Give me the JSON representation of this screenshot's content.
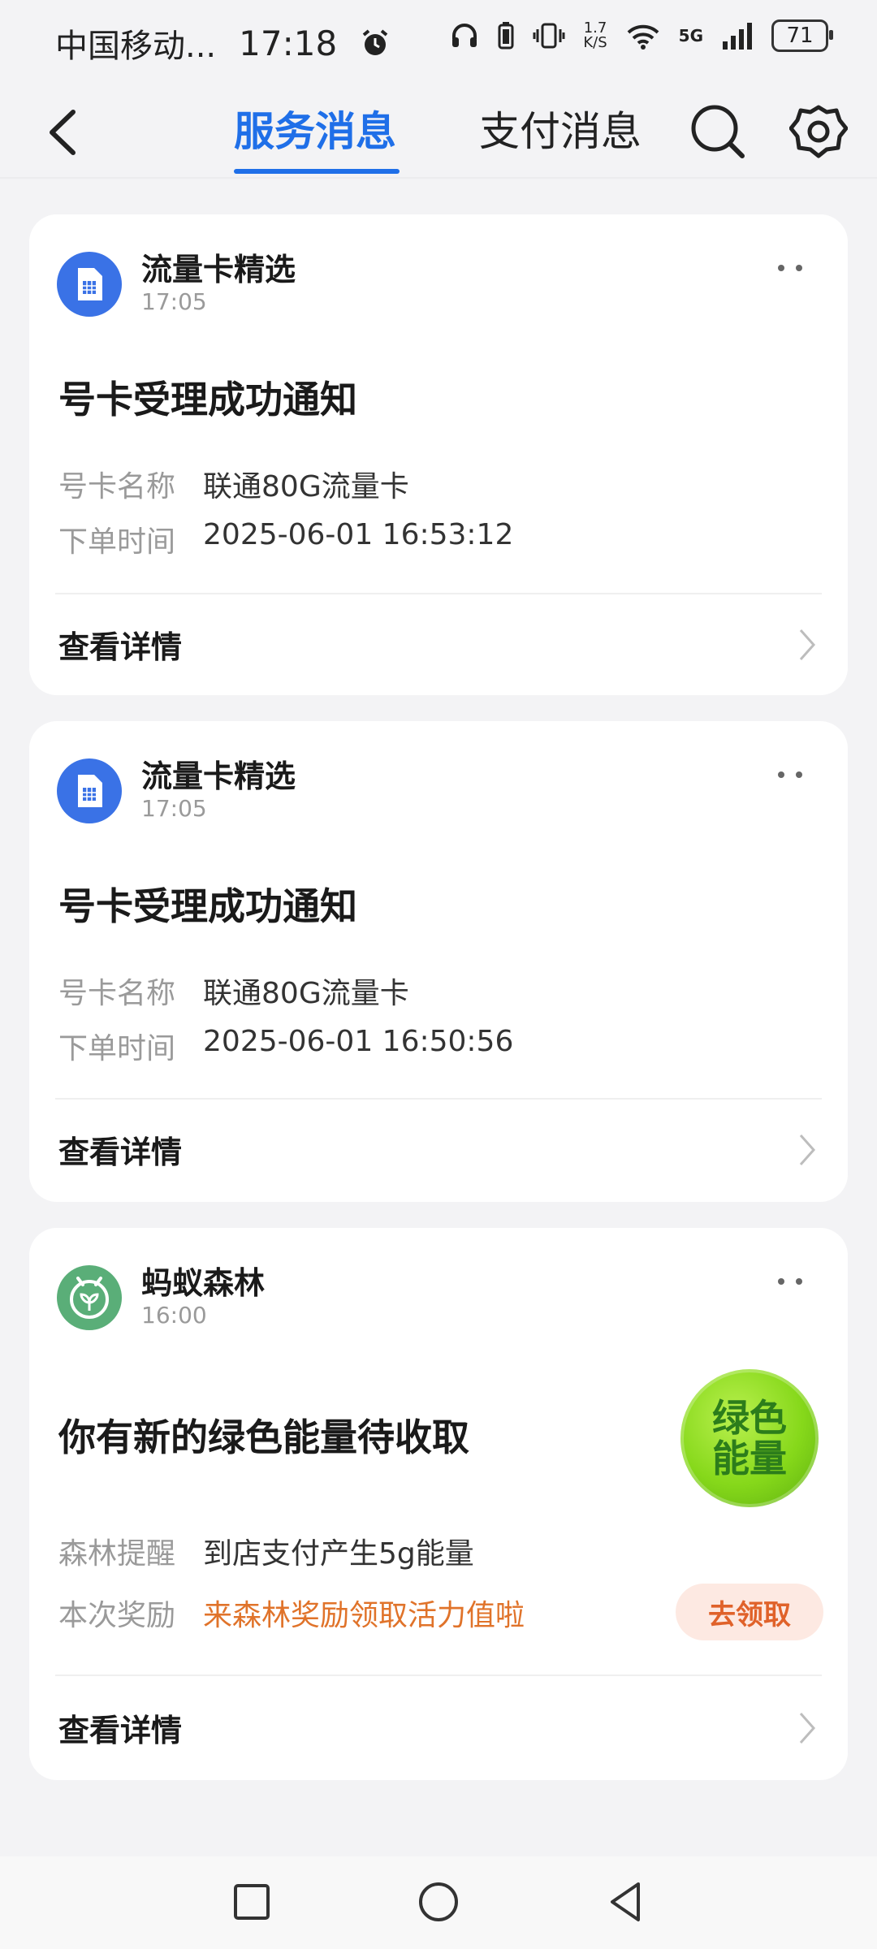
{
  "status_bar": {
    "carrier": "中国移动...",
    "time": "17:18",
    "speed_top": "1.7",
    "speed_bottom": "K/S",
    "network": "5G",
    "battery": "71"
  },
  "header": {
    "tabs": [
      {
        "label": "服务消息",
        "active": true
      },
      {
        "label": "支付消息",
        "active": false
      }
    ],
    "icons": [
      "back-icon",
      "search-icon",
      "gear-icon"
    ],
    "accent_color": "#1f6fe8"
  },
  "cards": [
    {
      "sender": "流量卡精选",
      "time": "17:05",
      "title": "号卡受理成功通知",
      "rows": [
        {
          "label": "号卡名称",
          "value": "联通80G流量卡"
        },
        {
          "label": "下单时间",
          "value": "2025-06-01 16:53:12"
        }
      ],
      "detail_label": "查看详情"
    },
    {
      "sender": "流量卡精选",
      "time": "17:05",
      "title": "号卡受理成功通知",
      "rows": [
        {
          "label": "号卡名称",
          "value": "联通80G流量卡"
        },
        {
          "label": "下单时间",
          "value": "2025-06-01 16:50:56"
        }
      ],
      "detail_label": "查看详情"
    },
    {
      "sender": "蚂蚁森林",
      "time": "16:00",
      "title": "你有新的绿色能量待收取",
      "badge_line1": "绿色",
      "badge_line2": "能量",
      "rows": [
        {
          "label": "森林提醒",
          "value": "到店支付产生5g能量"
        },
        {
          "label": "本次奖励",
          "value": "来森林奖励领取活力值啦"
        }
      ],
      "claim_label": "去领取",
      "detail_label": "查看详情"
    }
  ],
  "nav_bar": {
    "icons": [
      "recents-square-icon",
      "home-circle-icon",
      "back-triangle-icon"
    ]
  }
}
